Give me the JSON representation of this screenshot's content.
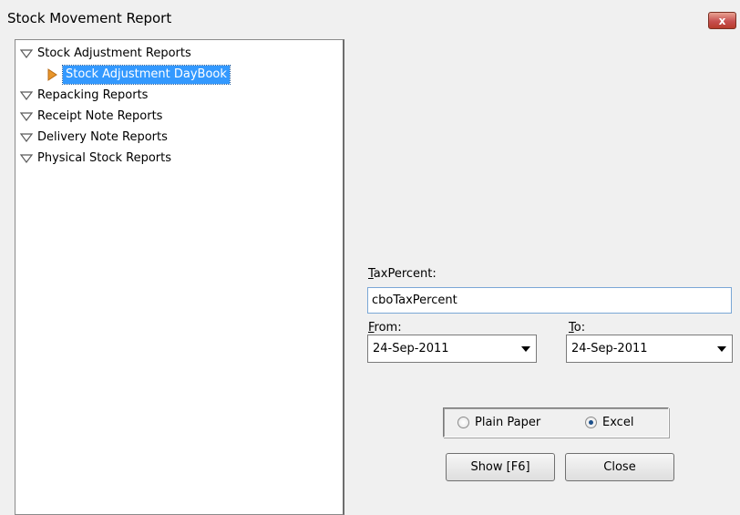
{
  "window": {
    "title": "Stock Movement Report",
    "close_label": "x"
  },
  "tree": {
    "items": [
      {
        "label": "Stock Adjustment Reports"
      },
      {
        "label": "Stock Adjustment DayBook"
      },
      {
        "label": "Repacking Reports"
      },
      {
        "label": "Receipt Note Reports"
      },
      {
        "label": "Delivery Note Reports"
      },
      {
        "label": "Physical Stock Reports"
      }
    ]
  },
  "form": {
    "tax_percent_label_accel": "T",
    "tax_percent_label_rest": "axPercent:",
    "tax_percent_value": "cboTaxPercent",
    "from_label_accel": "F",
    "from_label_rest": "rom:",
    "from_value": "24-Sep-2011",
    "to_label_accel": "T",
    "to_label_rest": "o:",
    "to_value": "24-Sep-2011"
  },
  "output": {
    "plain_paper_label": "Plain Paper",
    "excel_label": "Excel",
    "selected": "Excel"
  },
  "buttons": {
    "show_label": "Show [F6]",
    "close_label": "Close"
  }
}
